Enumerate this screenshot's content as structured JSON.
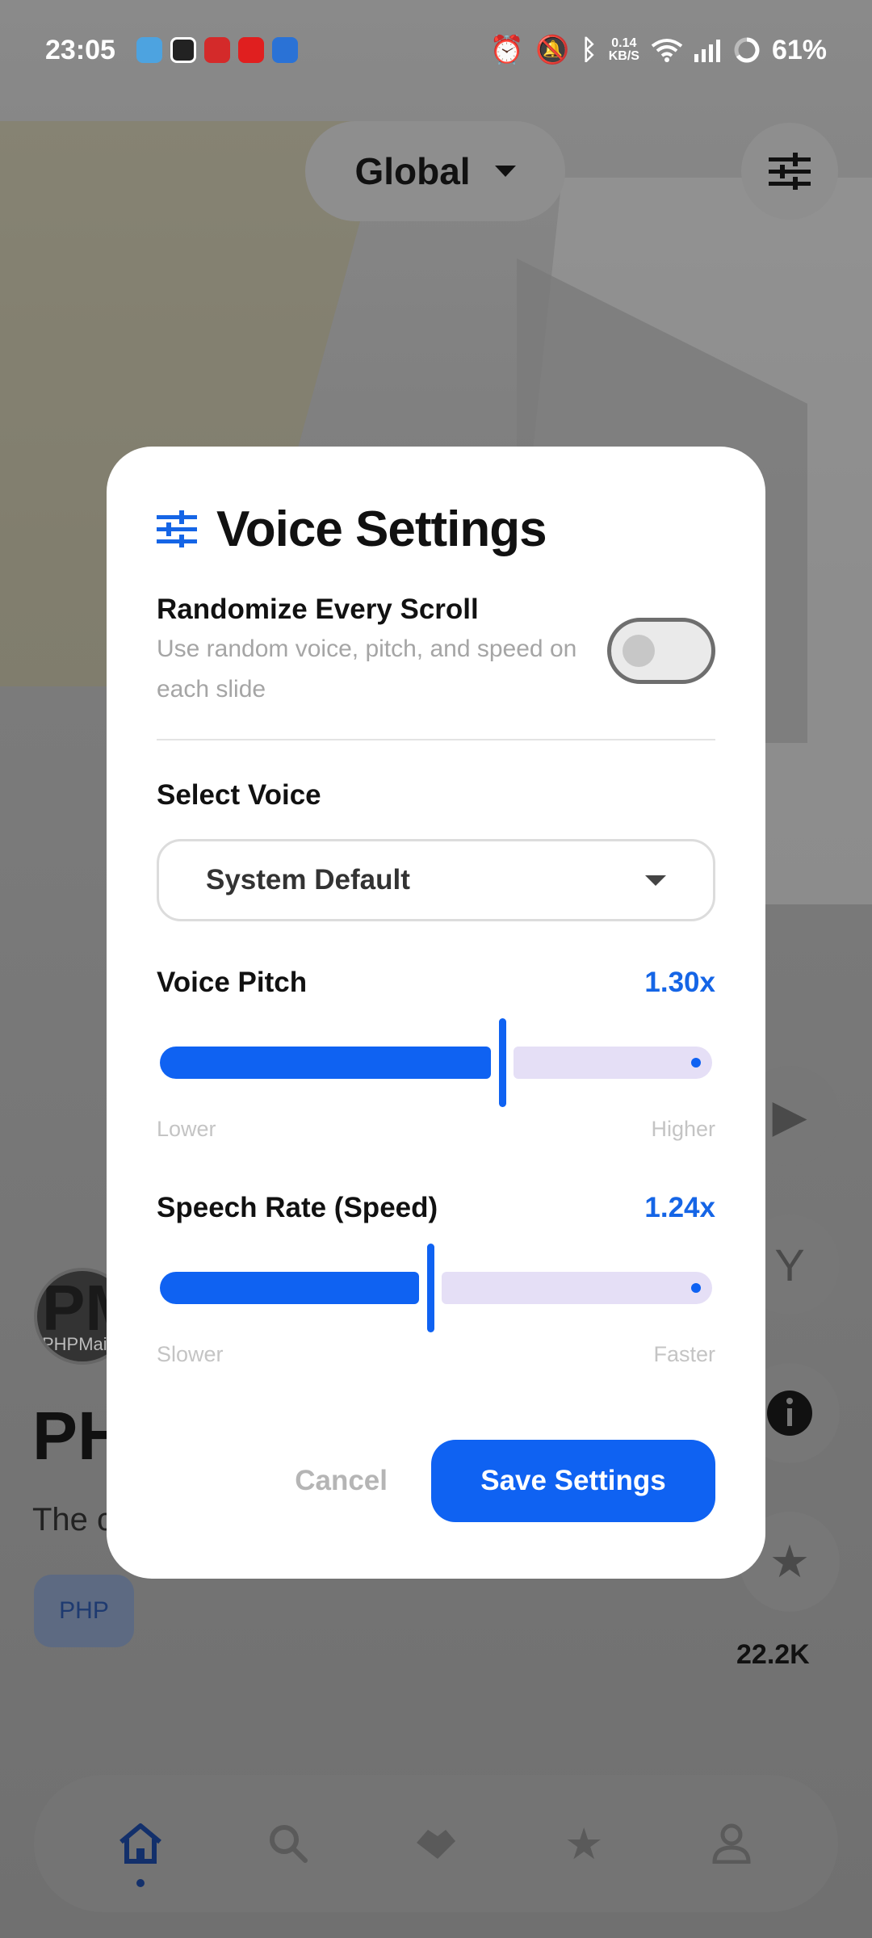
{
  "status_bar": {
    "time": "23:05",
    "net_speed_value": "0.14",
    "net_speed_unit": "KB/S",
    "battery": "61%"
  },
  "header": {
    "region_label": "Global"
  },
  "post": {
    "author_initials": "PM",
    "author_name_partial": "PHPMail",
    "title_partial": "PH",
    "desc_partial": "The c",
    "tag": "PHP",
    "star_count": "22.2K"
  },
  "modal": {
    "title": "Voice Settings",
    "randomize": {
      "title": "Randomize Every Scroll",
      "description": "Use random voice, pitch, and speed on each slide",
      "enabled": false
    },
    "voice_select": {
      "label": "Select Voice",
      "value": "System Default"
    },
    "pitch": {
      "label": "Voice Pitch",
      "value_text": "1.30x",
      "fraction": 0.62,
      "min_label": "Lower",
      "max_label": "Higher"
    },
    "rate": {
      "label": "Speech Rate (Speed)",
      "value_text": "1.24x",
      "fraction": 0.49,
      "min_label": "Slower",
      "max_label": "Faster"
    },
    "cancel_label": "Cancel",
    "save_label": "Save Settings"
  },
  "colors": {
    "accent": "#0f62f2",
    "track_rest": "#e5dff6",
    "overlay": "#6d6d6d"
  },
  "bottom_nav": {
    "items": [
      "home-icon",
      "search-icon",
      "handshake-icon",
      "star-icon",
      "profile-icon"
    ],
    "active": "home-icon"
  }
}
